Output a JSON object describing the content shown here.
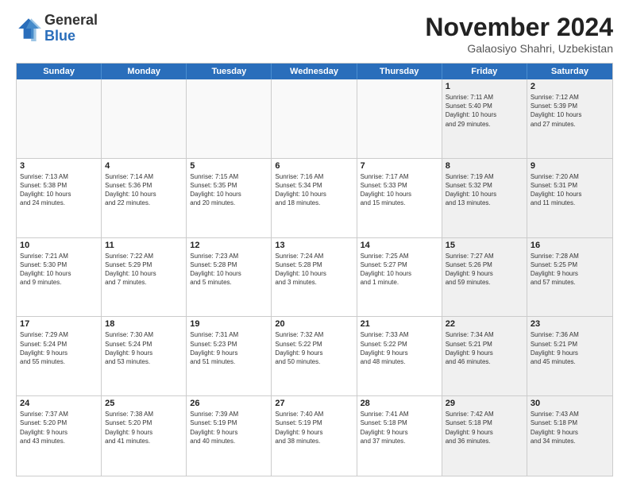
{
  "header": {
    "logo_general": "General",
    "logo_blue": "Blue",
    "month_title": "November 2024",
    "location": "Galaosiyo Shahri, Uzbekistan"
  },
  "weekdays": [
    "Sunday",
    "Monday",
    "Tuesday",
    "Wednesday",
    "Thursday",
    "Friday",
    "Saturday"
  ],
  "rows": [
    [
      {
        "day": "",
        "info": "",
        "empty": true
      },
      {
        "day": "",
        "info": "",
        "empty": true
      },
      {
        "day": "",
        "info": "",
        "empty": true
      },
      {
        "day": "",
        "info": "",
        "empty": true
      },
      {
        "day": "",
        "info": "",
        "empty": true
      },
      {
        "day": "1",
        "info": "Sunrise: 7:11 AM\nSunset: 5:40 PM\nDaylight: 10 hours\nand 29 minutes.",
        "shaded": true
      },
      {
        "day": "2",
        "info": "Sunrise: 7:12 AM\nSunset: 5:39 PM\nDaylight: 10 hours\nand 27 minutes.",
        "shaded": true
      }
    ],
    [
      {
        "day": "3",
        "info": "Sunrise: 7:13 AM\nSunset: 5:38 PM\nDaylight: 10 hours\nand 24 minutes."
      },
      {
        "day": "4",
        "info": "Sunrise: 7:14 AM\nSunset: 5:36 PM\nDaylight: 10 hours\nand 22 minutes."
      },
      {
        "day": "5",
        "info": "Sunrise: 7:15 AM\nSunset: 5:35 PM\nDaylight: 10 hours\nand 20 minutes."
      },
      {
        "day": "6",
        "info": "Sunrise: 7:16 AM\nSunset: 5:34 PM\nDaylight: 10 hours\nand 18 minutes."
      },
      {
        "day": "7",
        "info": "Sunrise: 7:17 AM\nSunset: 5:33 PM\nDaylight: 10 hours\nand 15 minutes."
      },
      {
        "day": "8",
        "info": "Sunrise: 7:19 AM\nSunset: 5:32 PM\nDaylight: 10 hours\nand 13 minutes.",
        "shaded": true
      },
      {
        "day": "9",
        "info": "Sunrise: 7:20 AM\nSunset: 5:31 PM\nDaylight: 10 hours\nand 11 minutes.",
        "shaded": true
      }
    ],
    [
      {
        "day": "10",
        "info": "Sunrise: 7:21 AM\nSunset: 5:30 PM\nDaylight: 10 hours\nand 9 minutes."
      },
      {
        "day": "11",
        "info": "Sunrise: 7:22 AM\nSunset: 5:29 PM\nDaylight: 10 hours\nand 7 minutes."
      },
      {
        "day": "12",
        "info": "Sunrise: 7:23 AM\nSunset: 5:28 PM\nDaylight: 10 hours\nand 5 minutes."
      },
      {
        "day": "13",
        "info": "Sunrise: 7:24 AM\nSunset: 5:28 PM\nDaylight: 10 hours\nand 3 minutes."
      },
      {
        "day": "14",
        "info": "Sunrise: 7:25 AM\nSunset: 5:27 PM\nDaylight: 10 hours\nand 1 minute."
      },
      {
        "day": "15",
        "info": "Sunrise: 7:27 AM\nSunset: 5:26 PM\nDaylight: 9 hours\nand 59 minutes.",
        "shaded": true
      },
      {
        "day": "16",
        "info": "Sunrise: 7:28 AM\nSunset: 5:25 PM\nDaylight: 9 hours\nand 57 minutes.",
        "shaded": true
      }
    ],
    [
      {
        "day": "17",
        "info": "Sunrise: 7:29 AM\nSunset: 5:24 PM\nDaylight: 9 hours\nand 55 minutes."
      },
      {
        "day": "18",
        "info": "Sunrise: 7:30 AM\nSunset: 5:24 PM\nDaylight: 9 hours\nand 53 minutes."
      },
      {
        "day": "19",
        "info": "Sunrise: 7:31 AM\nSunset: 5:23 PM\nDaylight: 9 hours\nand 51 minutes."
      },
      {
        "day": "20",
        "info": "Sunrise: 7:32 AM\nSunset: 5:22 PM\nDaylight: 9 hours\nand 50 minutes."
      },
      {
        "day": "21",
        "info": "Sunrise: 7:33 AM\nSunset: 5:22 PM\nDaylight: 9 hours\nand 48 minutes."
      },
      {
        "day": "22",
        "info": "Sunrise: 7:34 AM\nSunset: 5:21 PM\nDaylight: 9 hours\nand 46 minutes.",
        "shaded": true
      },
      {
        "day": "23",
        "info": "Sunrise: 7:36 AM\nSunset: 5:21 PM\nDaylight: 9 hours\nand 45 minutes.",
        "shaded": true
      }
    ],
    [
      {
        "day": "24",
        "info": "Sunrise: 7:37 AM\nSunset: 5:20 PM\nDaylight: 9 hours\nand 43 minutes."
      },
      {
        "day": "25",
        "info": "Sunrise: 7:38 AM\nSunset: 5:20 PM\nDaylight: 9 hours\nand 41 minutes."
      },
      {
        "day": "26",
        "info": "Sunrise: 7:39 AM\nSunset: 5:19 PM\nDaylight: 9 hours\nand 40 minutes."
      },
      {
        "day": "27",
        "info": "Sunrise: 7:40 AM\nSunset: 5:19 PM\nDaylight: 9 hours\nand 38 minutes."
      },
      {
        "day": "28",
        "info": "Sunrise: 7:41 AM\nSunset: 5:18 PM\nDaylight: 9 hours\nand 37 minutes."
      },
      {
        "day": "29",
        "info": "Sunrise: 7:42 AM\nSunset: 5:18 PM\nDaylight: 9 hours\nand 36 minutes.",
        "shaded": true
      },
      {
        "day": "30",
        "info": "Sunrise: 7:43 AM\nSunset: 5:18 PM\nDaylight: 9 hours\nand 34 minutes.",
        "shaded": true
      }
    ]
  ]
}
